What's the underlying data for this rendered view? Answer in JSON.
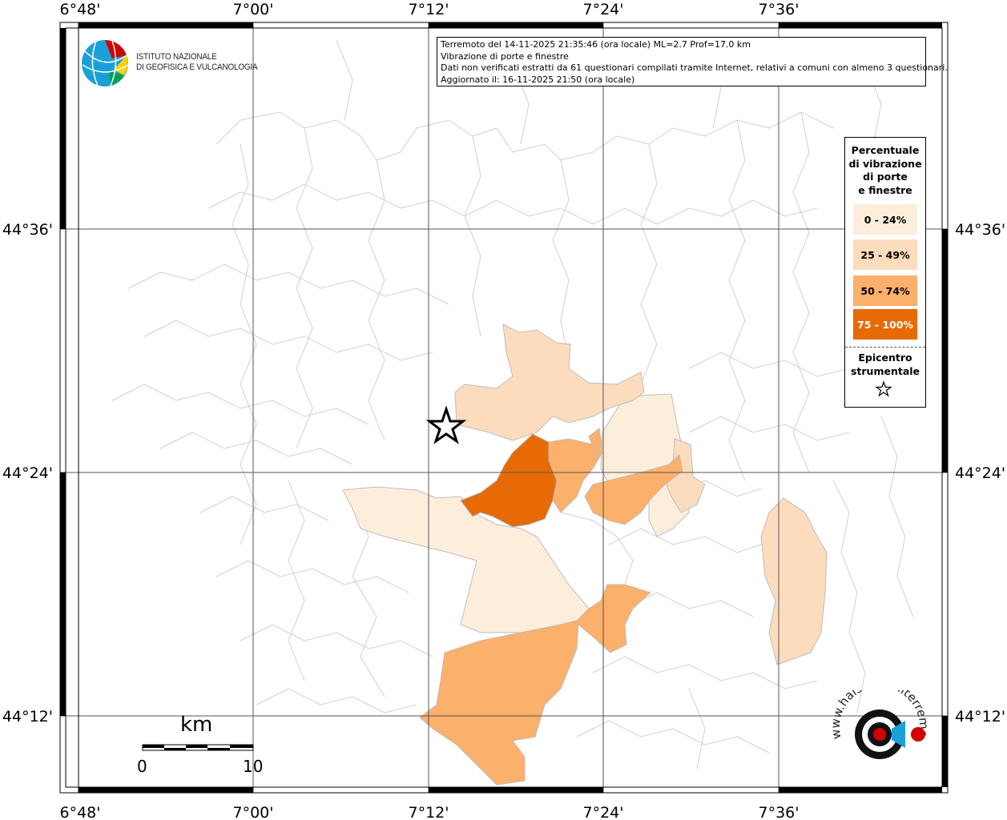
{
  "header": {
    "line1": "Terremoto del 14-11-2025 21:35:46 (ora locale) ML=2.7 Prof=17.0 km",
    "line2": "Vibrazione di porte e finestre",
    "line3": "Dati non verificati estratti da 61 questionari compilati tramite Internet, relativi a comuni con almeno 3 questionari.",
    "line4": "Aggiornato il: 16-11-2025 21:50 (ora locale)"
  },
  "logo_ingv": {
    "line1": "ISTITUTO NAZIONALE",
    "line2": "DI GEOFISICA E VULCANOLOGIA"
  },
  "axes": {
    "lon_labels": [
      "6°48'",
      "7°00'",
      "7°12'",
      "7°24'",
      "7°36'"
    ],
    "lat_labels": [
      "44°36'",
      "44°24'",
      "44°12'"
    ]
  },
  "legend": {
    "title_lines": [
      "Percentuale",
      "di vibrazione",
      "di porte",
      "e finestre"
    ],
    "classes": [
      {
        "label": "0 - 24%",
        "color": "#fdeedb"
      },
      {
        "label": "25 - 49%",
        "color": "#fcdcbd"
      },
      {
        "label": "50 - 74%",
        "color": "#fbb06b"
      },
      {
        "label": "75 - 100%",
        "color": "#e76a06"
      }
    ],
    "epicenter_lines": [
      "Epicentro",
      "strumentale"
    ]
  },
  "scalebar": {
    "unit": "km",
    "start": "0",
    "end": "10"
  },
  "logo_hsi": {
    "text": "www.haisentitoilterremoto.it",
    "icon": "loudspeaker-target-icon"
  }
}
